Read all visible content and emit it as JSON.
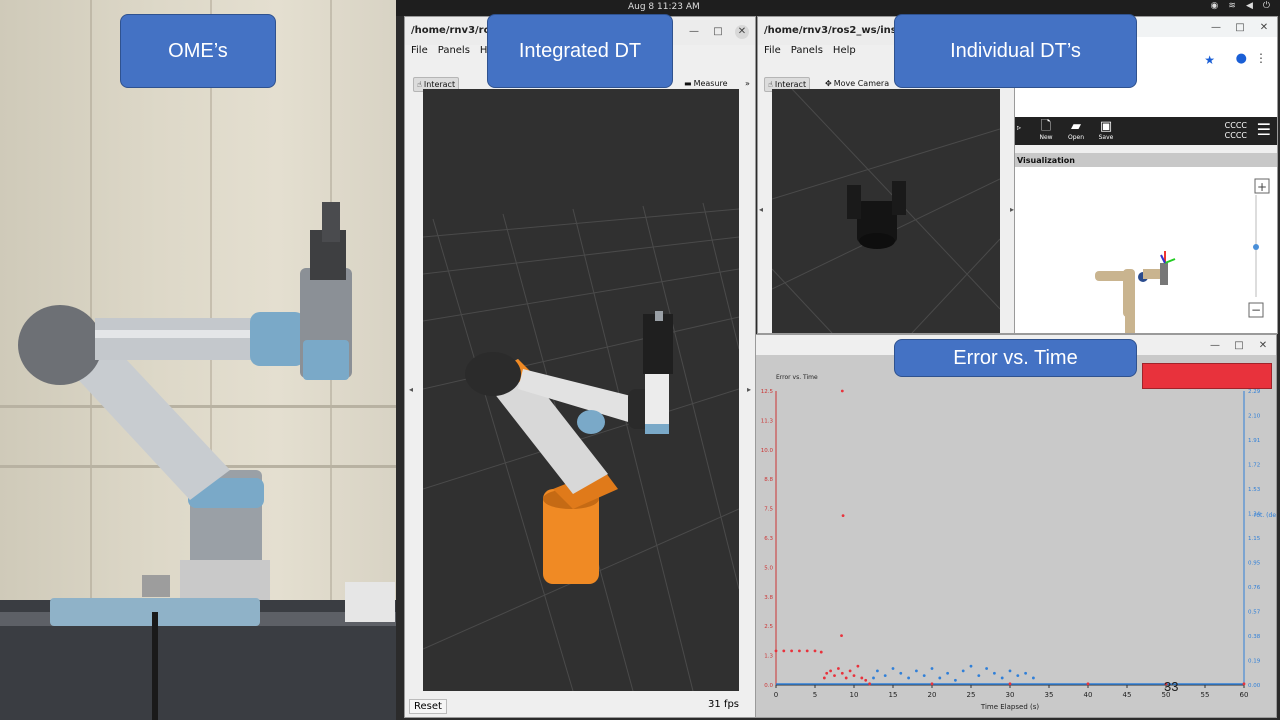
{
  "topbar": {
    "clock": "Aug 8  11:23 AM"
  },
  "callouts": {
    "ome": "OME’s",
    "integrated": "Integrated DT",
    "individual": "Individual DT’s",
    "error": "Error vs. Time"
  },
  "rviz_main": {
    "title": "/home/rnv3/ros2",
    "menu": {
      "file": "File",
      "panels": "Panels",
      "help": "He"
    },
    "tools": {
      "interact": "Interact",
      "measure": "Measure"
    },
    "reset": "Reset",
    "fps": "31 fps"
  },
  "rviz_second": {
    "title": "/home/rnv3/ros2_ws/install/",
    "menu": {
      "file": "File",
      "panels": "Panels",
      "help": "Help"
    },
    "tools": {
      "interact": "Interact",
      "move_camera": "Move Camera"
    }
  },
  "web_app": {
    "buttons": [
      "New",
      "Open",
      "Save"
    ],
    "status_text": [
      "CCCC",
      "CCCC"
    ],
    "panel_header": "Visualization"
  },
  "slide_number": "33",
  "colors": {
    "callout_fill": "#4472c4",
    "robot_orange": "#f08a24",
    "error_red": "#e8323c",
    "rot_blue": "#2f7fd8"
  },
  "icons": [
    "hand-icon",
    "ruler-icon",
    "camera-icon",
    "star-icon",
    "account-icon",
    "menu-icon",
    "new-file-icon",
    "folder-icon",
    "save-icon",
    "zoom-in-icon",
    "zoom-out-icon"
  ],
  "chart_data": {
    "type": "scatter",
    "title": "Error vs. Time",
    "xlabel": "Time Elapsed (s)",
    "ylabel_right": "rot. (deg)",
    "x_ticks": [
      0,
      5,
      10,
      15,
      20,
      25,
      30,
      35,
      40,
      45,
      50,
      55,
      60
    ],
    "y_left_ticks": [
      "0.0",
      "1.3",
      "2.5",
      "3.8",
      "5.0",
      "6.3",
      "7.5",
      "8.8",
      "10.0",
      "11.3",
      "12.5"
    ],
    "y_right_ticks": [
      "0.00",
      "0.19",
      "0.38",
      "0.57",
      "0.76",
      "0.95",
      "1.15",
      "1.34",
      "1.53",
      "1.72",
      "1.91",
      "2.10",
      "2.29"
    ],
    "xlim": [
      0,
      60
    ],
    "ylim_left": [
      0,
      12.5
    ],
    "ylim_right": [
      0,
      2.29
    ],
    "series": [
      {
        "color": "#e8323c",
        "axis": "left",
        "points": [
          [
            0,
            1.45
          ],
          [
            1,
            1.45
          ],
          [
            2,
            1.45
          ],
          [
            3,
            1.45
          ],
          [
            4,
            1.45
          ],
          [
            5,
            1.45
          ],
          [
            5.8,
            1.4
          ],
          [
            6.2,
            0.3
          ],
          [
            6.5,
            0.5
          ],
          [
            7,
            0.6
          ],
          [
            7.5,
            0.4
          ],
          [
            8,
            0.7
          ],
          [
            8.5,
            0.5
          ],
          [
            9,
            0.3
          ],
          [
            9.5,
            0.6
          ],
          [
            10,
            0.4
          ],
          [
            10.5,
            0.8
          ],
          [
            11,
            0.3
          ],
          [
            11.5,
            0.2
          ],
          [
            8.5,
            12.5
          ],
          [
            8.6,
            7.2
          ],
          [
            8.4,
            2.1
          ],
          [
            12,
            0.05
          ],
          [
            20,
            0.05
          ],
          [
            30,
            0.05
          ],
          [
            40,
            0.05
          ],
          [
            50,
            0.05
          ],
          [
            60,
            0.05
          ]
        ]
      },
      {
        "color": "#2f7fd8",
        "axis": "left",
        "points": [
          [
            12.5,
            0.3
          ],
          [
            13,
            0.6
          ],
          [
            14,
            0.4
          ],
          [
            15,
            0.7
          ],
          [
            16,
            0.5
          ],
          [
            17,
            0.3
          ],
          [
            18,
            0.6
          ],
          [
            19,
            0.4
          ],
          [
            20,
            0.7
          ],
          [
            21,
            0.3
          ],
          [
            22,
            0.5
          ],
          [
            23,
            0.2
          ],
          [
            24,
            0.6
          ],
          [
            25,
            0.8
          ],
          [
            26,
            0.4
          ],
          [
            27,
            0.7
          ],
          [
            28,
            0.5
          ],
          [
            29,
            0.3
          ],
          [
            30,
            0.6
          ],
          [
            31,
            0.4
          ],
          [
            32,
            0.5
          ],
          [
            33,
            0.3
          ]
        ]
      }
    ]
  }
}
